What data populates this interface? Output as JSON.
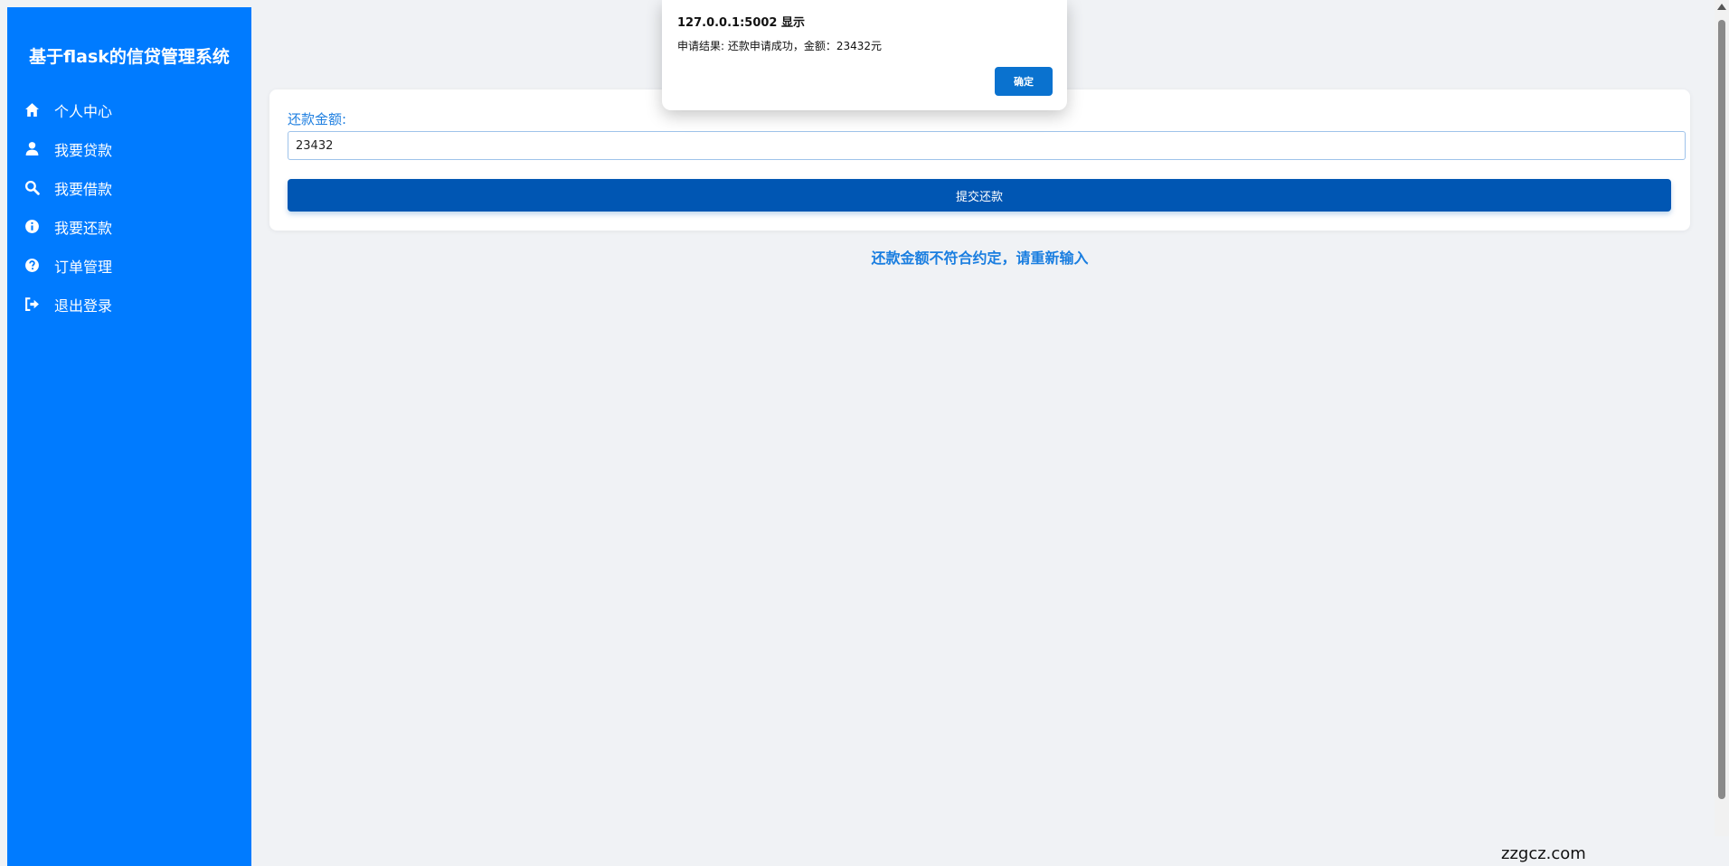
{
  "sidebar": {
    "title": "基于flask的信贷管理系统",
    "items": [
      {
        "label": "个人中心",
        "icon": "home-icon"
      },
      {
        "label": "我要贷款",
        "icon": "user-icon"
      },
      {
        "label": "我要借款",
        "icon": "search-icon"
      },
      {
        "label": "我要还款",
        "icon": "info-icon"
      },
      {
        "label": "订单管理",
        "icon": "question-icon"
      },
      {
        "label": "退出登录",
        "icon": "sign-out-icon"
      }
    ]
  },
  "form": {
    "label": "还款金额:",
    "amount_value": "23432",
    "submit_label": "提交还款"
  },
  "error_message": "还款金额不符合约定，请重新输入",
  "dialog": {
    "title": "127.0.0.1:5002 显示",
    "message": "申请结果: 还款申请成功，金额：23432元",
    "ok_label": "确定"
  },
  "watermark": "zzgcz.com",
  "colors": {
    "sidebar": "#007bff",
    "primary_button": "#0056b3",
    "dialog_button": "#0a72cf",
    "background": "#f0f2f5"
  }
}
